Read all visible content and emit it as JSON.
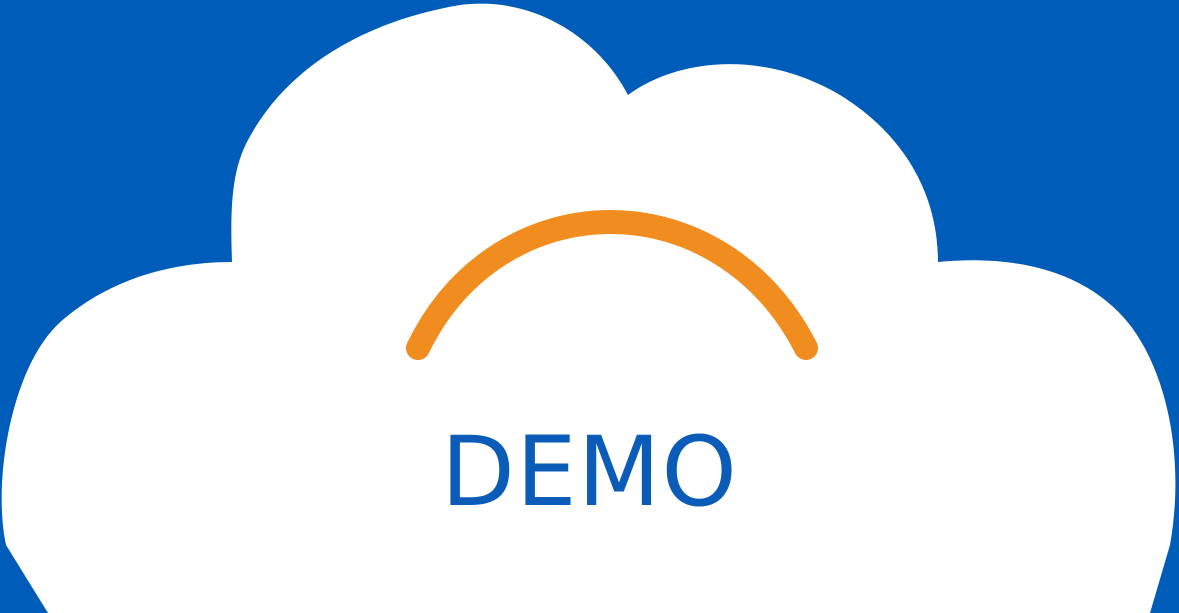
{
  "logo": {
    "label": "DEMO",
    "colors": {
      "background": "#005cb9",
      "cloud": "#ffffff",
      "arc": "#f18c1e",
      "label": "#0a5cb8"
    },
    "icon": "cloud-with-sun-arc-icon"
  }
}
